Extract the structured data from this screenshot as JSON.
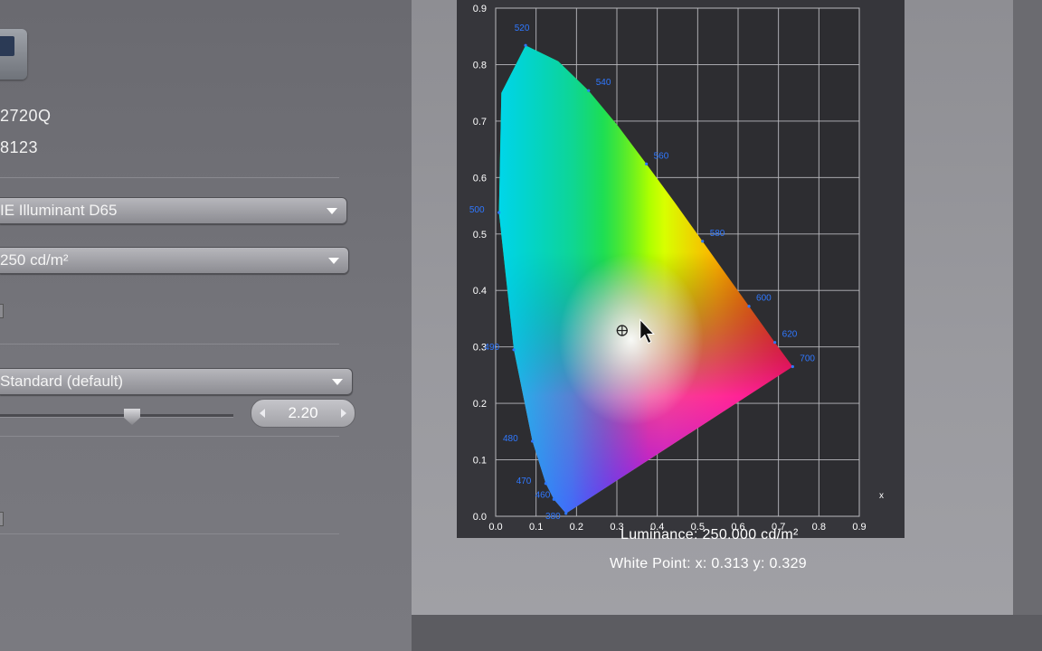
{
  "left": {
    "model_fragment": "2720Q",
    "serial_fragment": "8123",
    "white_point_select": "IE Illuminant D65",
    "luminance_select": "250 cd/m²",
    "gamma_select": "Standard (default)",
    "gamma_value": "2.20"
  },
  "chart_data": {
    "type": "scatter",
    "title": "",
    "xlabel": "x",
    "ylabel": "",
    "xlim": [
      0.0,
      0.9
    ],
    "ylim": [
      0.0,
      0.9
    ],
    "x_ticks": [
      "0.0",
      "0.1",
      "0.2",
      "0.3",
      "0.4",
      "0.5",
      "0.6",
      "0.7",
      "0.8",
      "0.9"
    ],
    "y_ticks": [
      "0.0",
      "0.1",
      "0.2",
      "0.3",
      "0.4",
      "0.5",
      "0.6",
      "0.7",
      "0.8",
      "0.9"
    ],
    "grid": true,
    "spectral_labels": [
      {
        "nm": "380",
        "x": 0.174,
        "y": 0.005
      },
      {
        "nm": "460",
        "x": 0.144,
        "y": 0.03
      },
      {
        "nm": "470",
        "x": 0.124,
        "y": 0.058
      },
      {
        "nm": "480",
        "x": 0.091,
        "y": 0.133
      },
      {
        "nm": "490",
        "x": 0.045,
        "y": 0.295
      },
      {
        "nm": "500",
        "x": 0.008,
        "y": 0.538
      },
      {
        "nm": "520",
        "x": 0.074,
        "y": 0.834
      },
      {
        "nm": "540",
        "x": 0.23,
        "y": 0.754
      },
      {
        "nm": "560",
        "x": 0.373,
        "y": 0.624
      },
      {
        "nm": "580",
        "x": 0.512,
        "y": 0.487
      },
      {
        "nm": "600",
        "x": 0.627,
        "y": 0.372
      },
      {
        "nm": "620",
        "x": 0.691,
        "y": 0.308
      },
      {
        "nm": "700",
        "x": 0.735,
        "y": 0.265
      }
    ],
    "white_point": {
      "x": 0.313,
      "y": 0.329
    },
    "spectral_color": "#2f78ff"
  },
  "captions": {
    "luminance": "Luminance: 250.000 cd/m²",
    "white_point": "White Point: x: 0.313  y: 0.329"
  }
}
